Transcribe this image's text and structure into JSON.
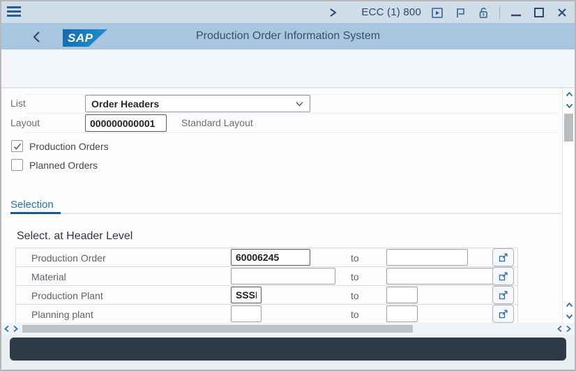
{
  "topbar": {
    "system": "ECC (1) 800"
  },
  "titlebar": {
    "logo_text": "SAP",
    "title": "Production Order Information System"
  },
  "toolbar": {
    "command_value": "",
    "cancel": "Cancel",
    "more": "More",
    "exit": "Exit"
  },
  "form": {
    "list_label": "List",
    "list_value": "Order Headers",
    "layout_label": "Layout",
    "layout_value": "000000000001",
    "layout_desc": "Standard Layout",
    "checkboxes": [
      {
        "label": "Production Orders",
        "checked": true
      },
      {
        "label": "Planned Orders",
        "checked": false
      }
    ],
    "tab_selection": "Selection",
    "section_title": "Select. at Header Level",
    "to_label": "to",
    "rows": [
      {
        "label": "Production Order",
        "from": "60006245",
        "to": ""
      },
      {
        "label": "Material",
        "from": "",
        "to": ""
      },
      {
        "label": "Production Plant",
        "from": "SSSE",
        "to": ""
      },
      {
        "label": "Planning plant",
        "from": "",
        "to": ""
      }
    ]
  },
  "colors": {
    "accent_blue": "#1d5a96",
    "icon_blue": "#35618c",
    "titlebar_blue": "#a9c6e1",
    "topbar_blue": "#cfdde9",
    "highlight_purple": "#a1278e",
    "check_green": "#17a23b",
    "statusbar_dark": "#2e3a47"
  }
}
